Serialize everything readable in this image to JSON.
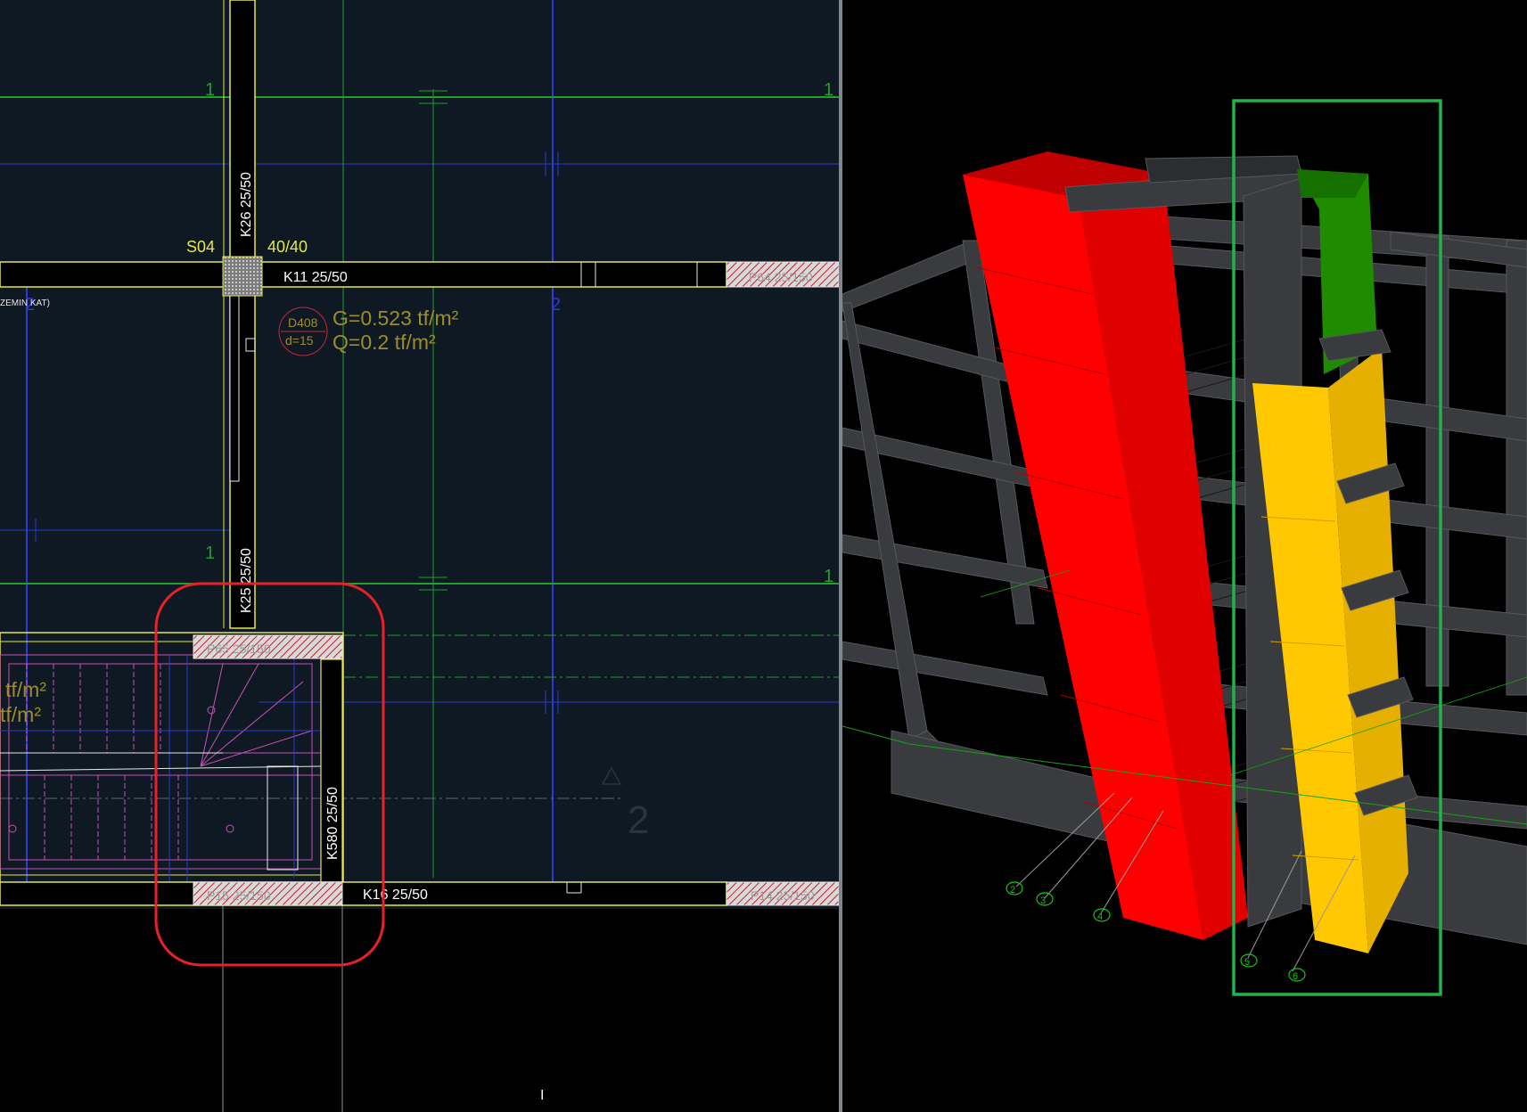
{
  "plan": {
    "column_label": "S04",
    "column_size": "40/40",
    "beam_top_vertical": "K26 25/50",
    "beam_mid_vertical": "K25 25/50",
    "beam_top_horizontal": "K11 25/50",
    "beam_top_right": "P64 25/150",
    "beam_stair_vertical": "K580 25/50",
    "beam_bottom": "K16 25/50",
    "beam_bottom_right": "P14 25/150",
    "stair_top_beam": "P65 25/150",
    "stair_bottom_beam": "P15 25/150",
    "floor_label": "ZEMIN KAT)",
    "slab_id": "D408",
    "slab_thickness": "d=15",
    "load_g": "G=0.523 tf/m²",
    "load_q": "Q=0.2 tf/m²",
    "partial_load_1": "tf/m²",
    "partial_load_2": "tf/m²",
    "axis_1": "1",
    "axis_2": "2",
    "axis_big_2": "2",
    "cursor": "I"
  },
  "model": {
    "axis_labels": [
      "2",
      "3",
      "4",
      "5",
      "6"
    ],
    "colors": {
      "red_wall": "#ff0000",
      "yellow_wall": "#ffc800",
      "green_panel": "#1f8c00",
      "frame": "#3a3b3e",
      "highlight_box": "#22b14c"
    }
  },
  "annotation_colors": {
    "plan_highlight": "#e8202a"
  }
}
